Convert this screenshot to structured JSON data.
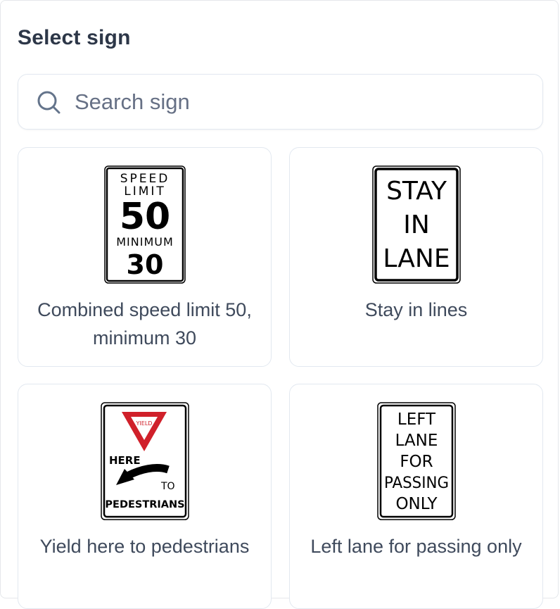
{
  "panel": {
    "title": "Select sign"
  },
  "search": {
    "placeholder": "Search sign",
    "value": ""
  },
  "signs": [
    {
      "name": "Combined speed limit 50, minimum 30",
      "plate": {
        "line1": "SPEED",
        "line2": "LIMIT",
        "speed": "50",
        "min_label": "MINIMUM",
        "min_speed": "30"
      }
    },
    {
      "name": "Stay in lines",
      "plate": {
        "line1": "STAY",
        "line2": "IN",
        "line3": "LANE"
      }
    },
    {
      "name": "Yield here to pedestrians",
      "plate": {
        "yield": "YIELD",
        "here": "HERE",
        "to": "TO",
        "pedestrians": "PEDESTRIANS"
      }
    },
    {
      "name": "Left lane for passing only",
      "plate": {
        "line1": "LEFT",
        "line2": "LANE",
        "line3": "FOR",
        "line4": "PASSING",
        "line5": "ONLY"
      }
    }
  ],
  "colors": {
    "yield_red": "#d0202a",
    "border": "#e2e8f0",
    "title": "#2d3748"
  }
}
